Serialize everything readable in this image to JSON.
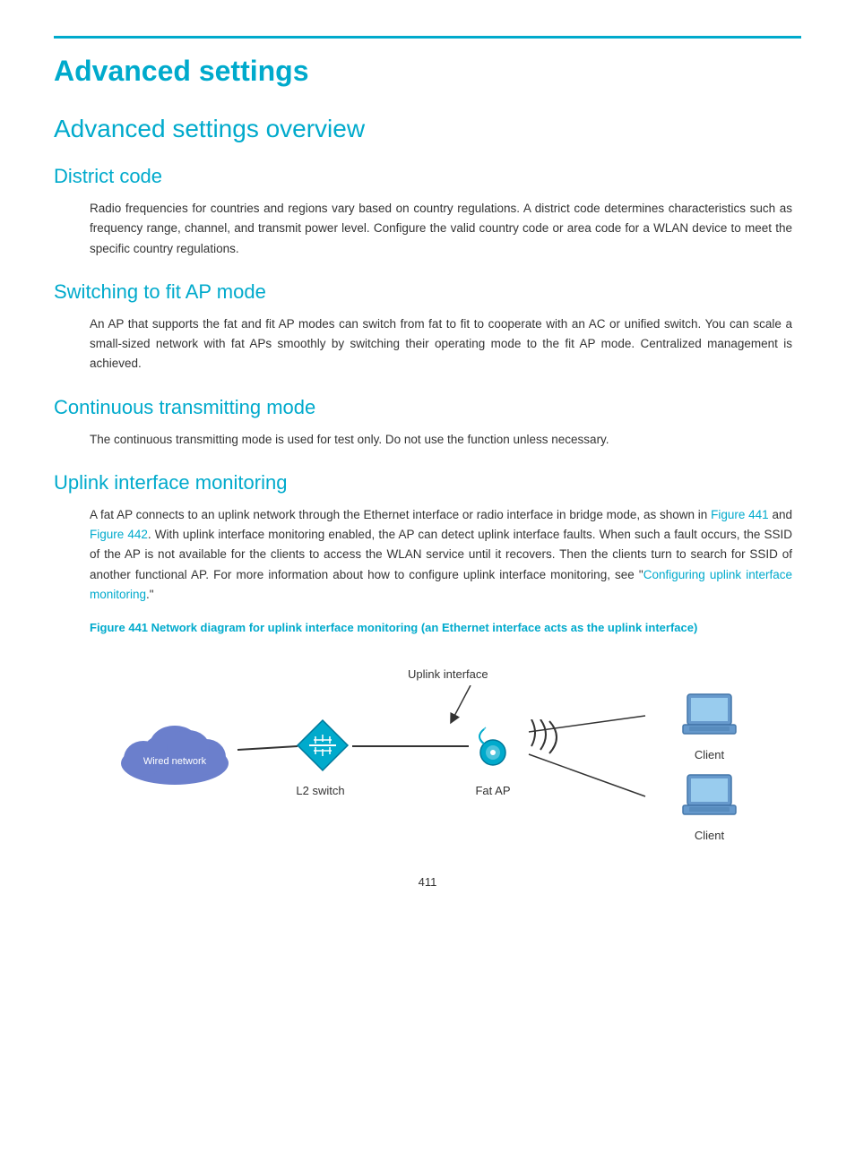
{
  "page": {
    "title": "Advanced settings",
    "number": "411"
  },
  "sections": {
    "overview_title": "Advanced settings overview",
    "district_code": {
      "title": "District code",
      "body": "Radio frequencies for countries and regions vary based on country regulations. A district code determines characteristics such as frequency range, channel, and transmit power level. Configure the valid country code or area code for a WLAN device to meet the specific country regulations."
    },
    "switching": {
      "title": "Switching to fit AP mode",
      "body": "An AP that supports the fat and fit AP modes can switch from fat to fit to cooperate with an AC or unified switch. You can scale a small-sized network with fat APs smoothly by switching their operating mode to the fit AP mode. Centralized management is achieved."
    },
    "continuous": {
      "title": "Continuous transmitting mode",
      "body": "The continuous transmitting mode is used for test only. Do not use the function unless necessary."
    },
    "uplink": {
      "title": "Uplink interface monitoring",
      "body1": "A fat AP connects to an uplink network through the Ethernet interface or radio interface in bridge mode, as shown in ",
      "figure441_link": "Figure 441",
      "body2": " and ",
      "figure442_link": "Figure 442",
      "body3": ". With uplink interface monitoring enabled, the AP can detect uplink interface faults. When such a fault occurs, the SSID of the AP is not available for the clients to access the WLAN service until it recovers. Then the clients turn to search for SSID of another functional AP. For more information about how to configure uplink interface monitoring, see \"",
      "config_link": "Configuring uplink interface monitoring",
      "body4": ".\"",
      "figure_caption": "Figure 441 Network diagram for uplink interface monitoring (an Ethernet interface acts as the uplink interface)"
    }
  },
  "diagram": {
    "wired_network_label": "Wired network",
    "switch_label": "L2 switch",
    "ap_label": "Fat AP",
    "client1_label": "Client",
    "client2_label": "Client",
    "uplink_label": "Uplink  interface"
  }
}
